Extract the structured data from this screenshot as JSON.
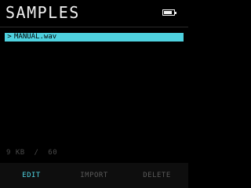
{
  "header": {
    "title": "SAMPLES",
    "battery_icon": "battery-icon"
  },
  "files": {
    "items": [
      {
        "chevron": ">",
        "name": "MANUAL.wav",
        "selected": true
      }
    ]
  },
  "storage": {
    "used": "9 KB",
    "separator": "/",
    "total": "60"
  },
  "footer": {
    "edit_label": "EDIT",
    "import_label": "IMPORT",
    "delete_label": "DELETE"
  },
  "colors": {
    "background": "#000000",
    "accent": "#4fd2e0",
    "text": "#f2f2f2",
    "dim_text": "#5a5a5a"
  }
}
